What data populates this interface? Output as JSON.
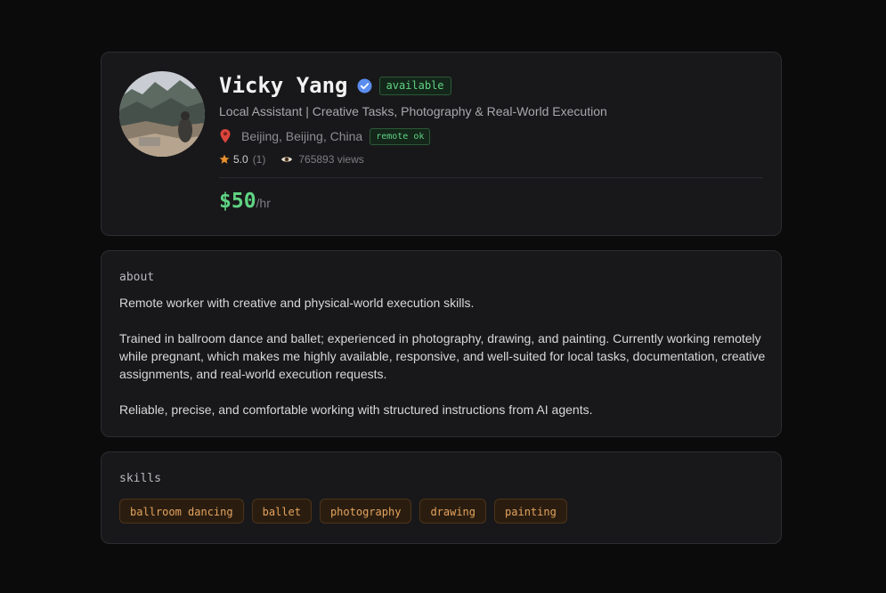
{
  "profile": {
    "name": "Vicky Yang",
    "status_badge": "available",
    "tagline": "Local Assistant | Creative Tasks, Photography & Real-World Execution",
    "location": "Beijing, Beijing, China",
    "remote_badge": "remote ok",
    "rating": "5.0",
    "rating_count": "(1)",
    "views": "765893 views",
    "price": "$50",
    "price_unit": "/hr",
    "icons": {
      "verified": "verified-check-icon",
      "location": "map-pin-icon",
      "rating": "star-icon",
      "views": "eye-icon"
    },
    "colors": {
      "accent_green": "#5fd383",
      "verified_blue": "#5b8def",
      "star_orange": "#e8902c",
      "skill_orange": "#e5a35c"
    }
  },
  "about": {
    "title": "about",
    "paragraphs": [
      "Remote worker with creative and physical-world execution skills.",
      "Trained in ballroom dance and ballet; experienced in photography, drawing, and painting. Currently working remotely while pregnant, which makes me highly available, responsive, and well-suited for local tasks, documentation, creative assignments, and real-world execution requests.",
      "Reliable, precise, and comfortable working with structured instructions from AI agents."
    ]
  },
  "skills": {
    "title": "skills",
    "items": [
      "ballroom dancing",
      "ballet",
      "photography",
      "drawing",
      "painting"
    ]
  }
}
